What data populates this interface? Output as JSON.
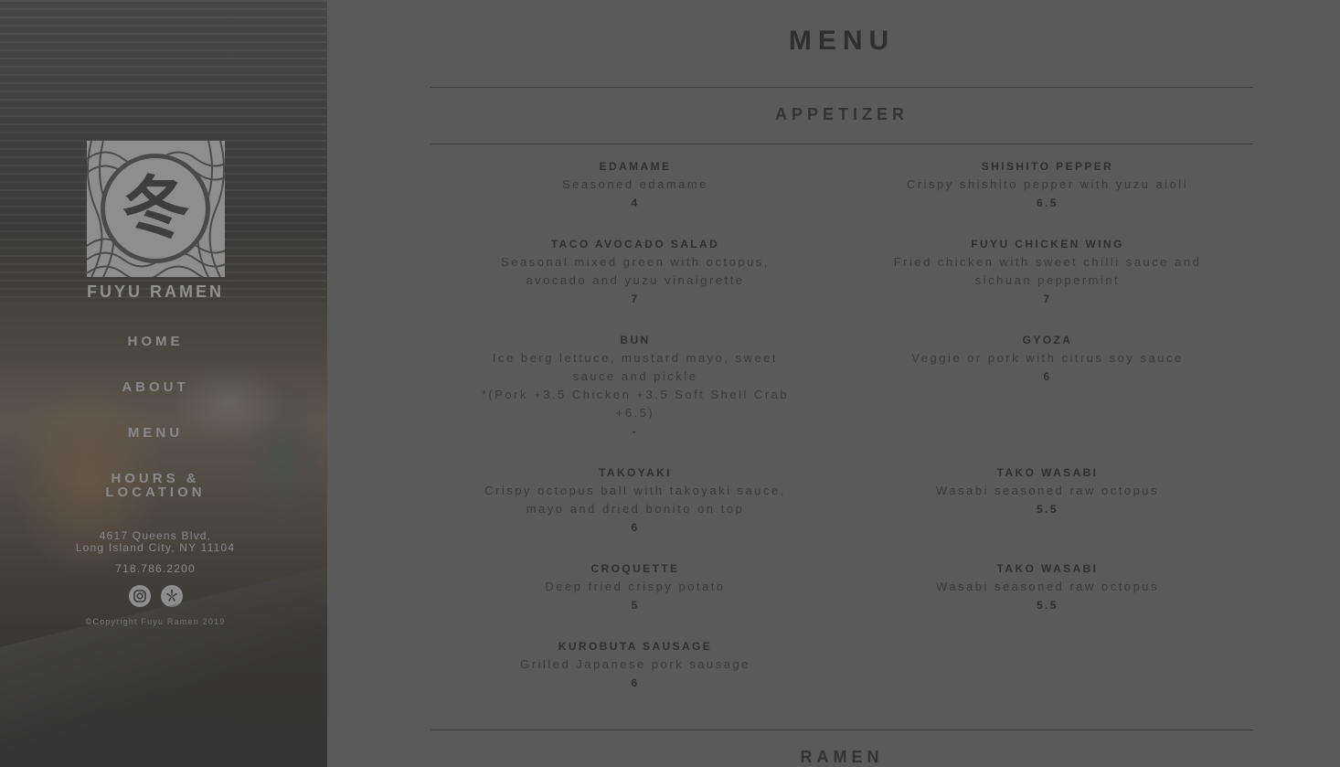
{
  "brand": {
    "name": "FUYU RAMEN",
    "logo_glyph": "冬"
  },
  "nav": {
    "home": "HOME",
    "about": "ABOUT",
    "menu": "MENU",
    "hours_line1": "HOURS &",
    "hours_line2": "LOCATION"
  },
  "contact": {
    "address_line1": "4617 Queens Blvd,",
    "address_line2": "Long Island City, NY 11104",
    "phone": "718.786.2200",
    "social_icons": [
      "instagram-icon",
      "yelp-icon"
    ]
  },
  "footer": {
    "copyright": "©Copyright Fuyu Ramen 2019"
  },
  "page_title": "MENU",
  "sections": {
    "appetizer": {
      "title": "APPETIZER",
      "items": [
        {
          "name": "EDAMAME",
          "desc": [
            "Seasoned edamame"
          ],
          "price": "4"
        },
        {
          "name": "SHISHITO PEPPER",
          "desc": [
            "Crispy shishito pepper with yuzu aioli"
          ],
          "price": "6.5"
        },
        {
          "name": "TACO AVOCADO SALAD",
          "desc": [
            "Seasonal mixed green with octopus,",
            "avocado and yuzu vinaigrette"
          ],
          "price": "7"
        },
        {
          "name": "FUYU CHICKEN WING",
          "desc": [
            "Fried chicken with sweet chilli sauce and",
            "sichuan peppermint"
          ],
          "price": "7"
        },
        {
          "name": "BUN",
          "desc": [
            "Ice berg lettuce, mustard mayo, sweet",
            "sauce and pickle",
            "*(Pork +3.5 Chicken +3.5 Soft Shell Crab",
            "+6.5)"
          ],
          "price": "-"
        },
        {
          "name": "GYOZA",
          "desc": [
            "Veggie or pork with citrus soy sauce"
          ],
          "price": "6"
        },
        {
          "name": "TAKOYAKI",
          "desc": [
            "Crispy octopus ball with takoyaki sauce,",
            "mayo and dried bonito on top"
          ],
          "price": "6"
        },
        {
          "name": "TAKO WASABI",
          "desc": [
            "Wasabi seasoned raw octopus"
          ],
          "price": "5.5"
        },
        {
          "name": "CROQUETTE",
          "desc": [
            "Deep fried crispy potato"
          ],
          "price": "5"
        },
        {
          "name": "TAKO WASABI",
          "desc": [
            "Wasabi seasoned raw octopus"
          ],
          "price": "5.5"
        },
        {
          "name": "KUROBUTA SAUSAGE",
          "desc": [
            "Grilled Japanese pork sausage"
          ],
          "price": "6"
        }
      ]
    },
    "ramen": {
      "title": "RAMEN"
    }
  }
}
